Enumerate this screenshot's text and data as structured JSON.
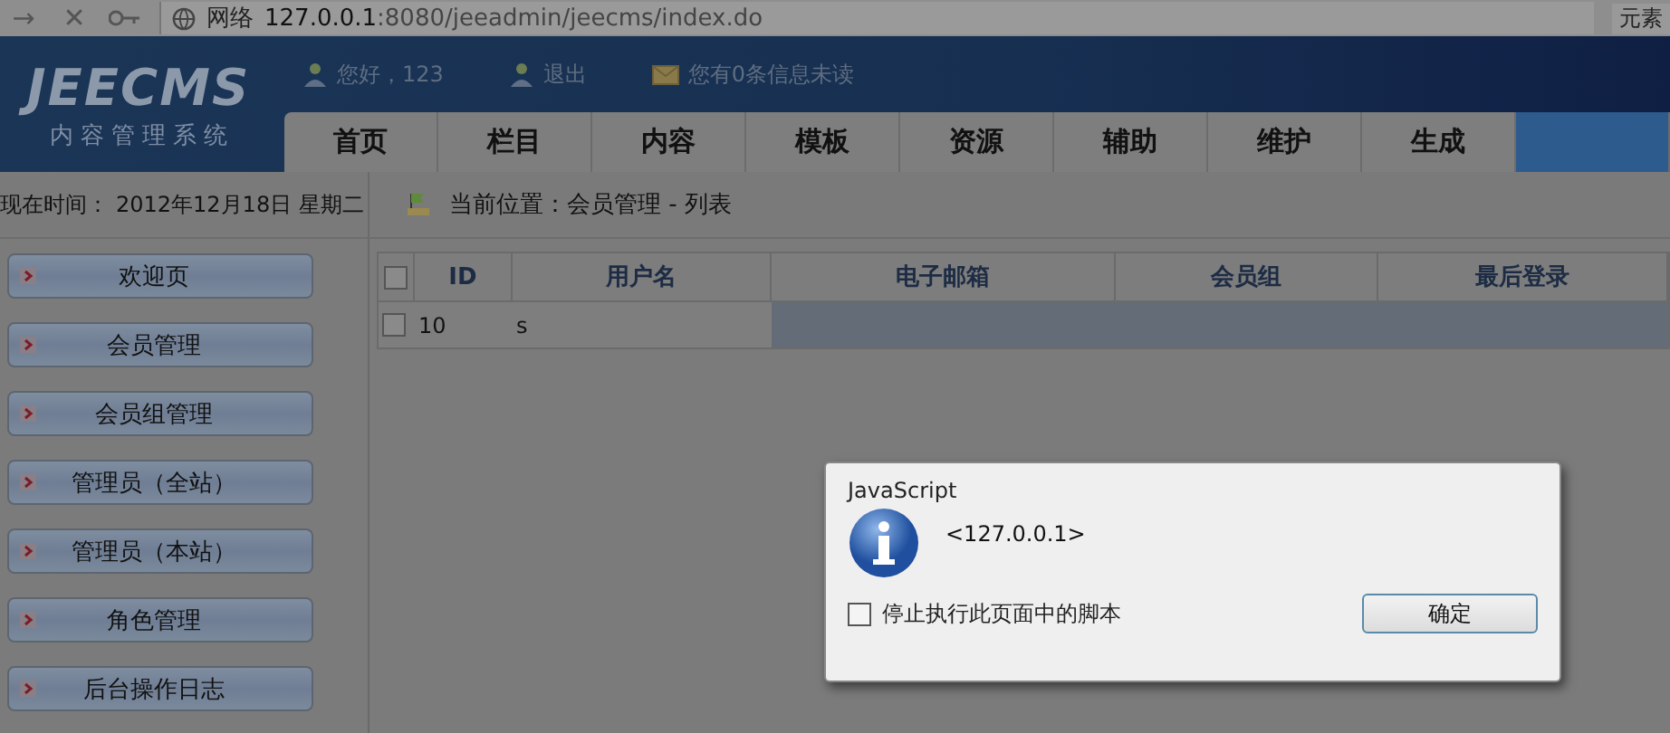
{
  "browser": {
    "nav_glyphs": [
      "→",
      "✕"
    ],
    "address_label": "网络",
    "address_host": "127.0.0.1",
    "address_rest": ":8080/jeeadmin/jeecms/index.do",
    "right_label": "元素"
  },
  "header": {
    "logo": "JEECMS",
    "logo_subtitle": "内容管理系统",
    "greeting": "您好，123",
    "logout": "退出",
    "messages": "您有0条信息未读"
  },
  "nav_tabs": [
    {
      "label": "首页",
      "selected": false
    },
    {
      "label": "栏目",
      "selected": false
    },
    {
      "label": "内容",
      "selected": false
    },
    {
      "label": "模板",
      "selected": false
    },
    {
      "label": "资源",
      "selected": false
    },
    {
      "label": "辅助",
      "selected": false
    },
    {
      "label": "维护",
      "selected": false
    },
    {
      "label": "生成",
      "selected": false
    },
    {
      "selected": true
    }
  ],
  "time_label": "现在时间：",
  "time_value": "2012年12月18日 星期二",
  "breadcrumb": "当前位置：会员管理 - 列表",
  "sidebar": {
    "items": [
      "欢迎页",
      "会员管理",
      "会员组管理",
      "管理员（全站）",
      "管理员（本站）",
      "角色管理",
      "后台操作日志"
    ]
  },
  "table": {
    "columns": [
      "ID",
      "用户名",
      "电子邮箱",
      "会员组",
      "最后登录"
    ],
    "header_checked": false,
    "rows": [
      {
        "checked": false,
        "cells": [
          "10",
          "s"
        ]
      }
    ]
  },
  "dialog": {
    "title": "JavaScript",
    "message": "<127.0.0.1>",
    "checkbox_label": "停止执行此页面中的脚本",
    "checked": false,
    "button": "确定"
  }
}
